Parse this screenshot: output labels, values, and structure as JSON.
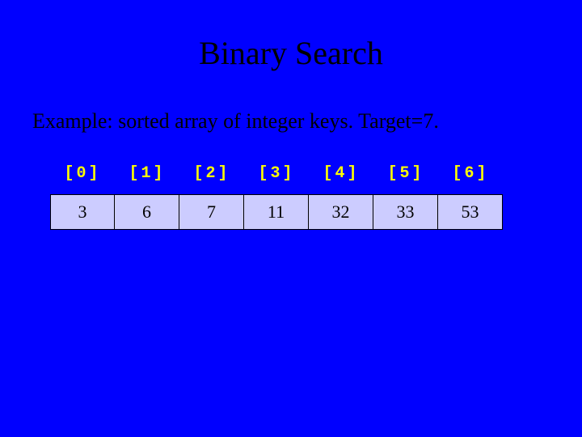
{
  "title": "Binary Search",
  "subtitle": "Example: sorted array of integer keys.  Target=7.",
  "array": {
    "indices": [
      "[0]",
      "[1]",
      "[2]",
      "[3]",
      "[4]",
      "[5]",
      "[6]"
    ],
    "values": [
      "3",
      "6",
      "7",
      "11",
      "32",
      "33",
      "53"
    ]
  }
}
